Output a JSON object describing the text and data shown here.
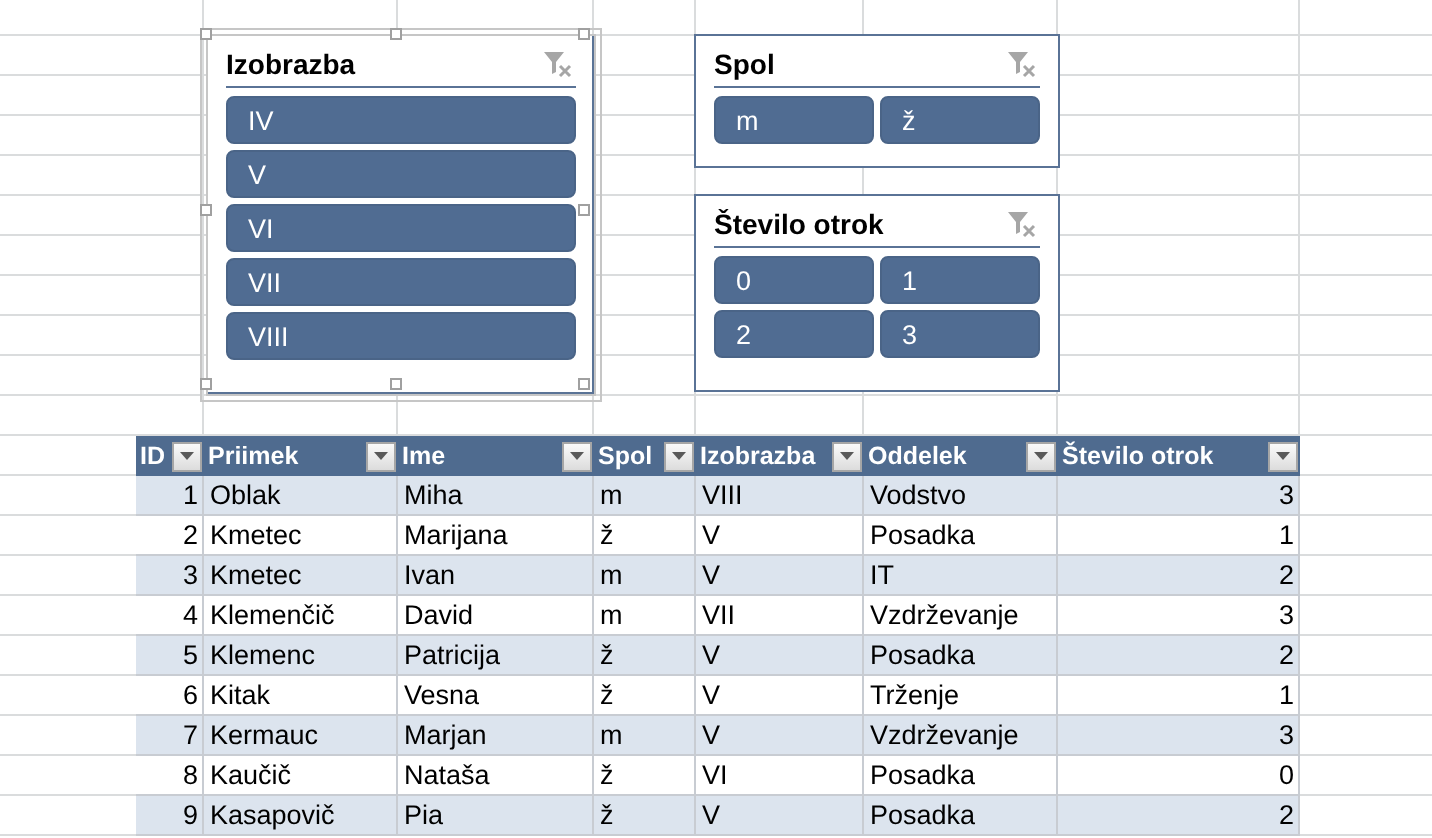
{
  "slicers": [
    {
      "title": "Izobrazba",
      "selected": true,
      "items": [
        {
          "label": "IV",
          "selected": true
        },
        {
          "label": "V",
          "selected": true
        },
        {
          "label": "VI",
          "selected": true
        },
        {
          "label": "VII",
          "selected": true
        },
        {
          "label": "VIII",
          "selected": true
        }
      ]
    },
    {
      "title": "Spol",
      "selected": false,
      "items": [
        {
          "label": "m",
          "selected": true
        },
        {
          "label": "ž",
          "selected": true
        }
      ]
    },
    {
      "title": "Število otrok",
      "selected": false,
      "items": [
        {
          "label": "0",
          "selected": true
        },
        {
          "label": "1",
          "selected": true
        },
        {
          "label": "2",
          "selected": true
        },
        {
          "label": "3",
          "selected": true
        }
      ]
    }
  ],
  "table": {
    "columns": [
      {
        "label": "ID",
        "kind": "number"
      },
      {
        "label": "Priimek",
        "kind": "text"
      },
      {
        "label": "Ime",
        "kind": "text"
      },
      {
        "label": "Spol",
        "kind": "text"
      },
      {
        "label": "Izobrazba",
        "kind": "text"
      },
      {
        "label": "Oddelek",
        "kind": "text"
      },
      {
        "label": "Število otrok",
        "kind": "number"
      }
    ],
    "rows": [
      [
        "1",
        "Oblak",
        "Miha",
        "m",
        "VIII",
        "Vodstvo",
        "3"
      ],
      [
        "2",
        "Kmetec",
        "Marijana",
        "ž",
        "V",
        "Posadka",
        "1"
      ],
      [
        "3",
        "Kmetec",
        "Ivan",
        "m",
        "V",
        "IT",
        "2"
      ],
      [
        "4",
        "Klemenčič",
        "David",
        "m",
        "VII",
        "Vzdrževanje",
        "3"
      ],
      [
        "5",
        "Klemenc",
        "Patricija",
        "ž",
        "V",
        "Posadka",
        "2"
      ],
      [
        "6",
        "Kitak",
        "Vesna",
        "ž",
        "V",
        "Trženje",
        "1"
      ],
      [
        "7",
        "Kermauc",
        "Marjan",
        "m",
        "V",
        "Vzdrževanje",
        "3"
      ],
      [
        "8",
        "Kaučič",
        "Nataša",
        "ž",
        "VI",
        "Posadka",
        "0"
      ],
      [
        "9",
        "Kasapovič",
        "Pia",
        "ž",
        "V",
        "Posadka",
        "2"
      ]
    ]
  }
}
